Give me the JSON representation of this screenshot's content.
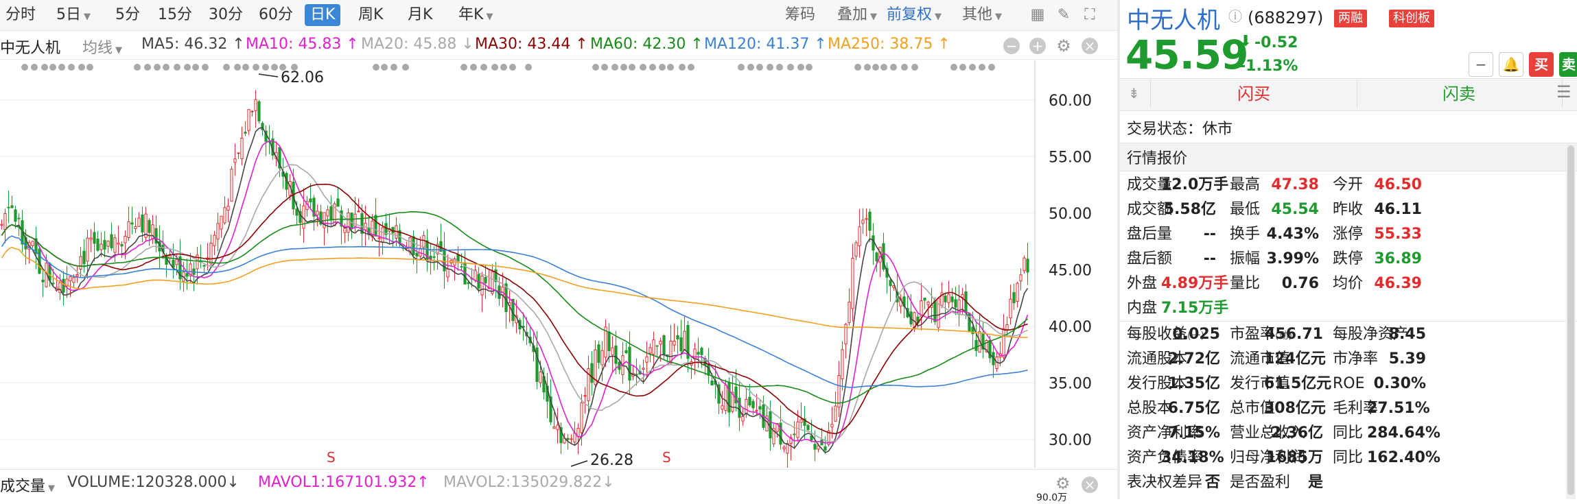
{
  "toolbar": {
    "periods": [
      "分时",
      "5日",
      "5分",
      "15分",
      "30分",
      "60分",
      "日K",
      "周K",
      "月K",
      "年K"
    ],
    "active": "日K",
    "chouma": "筹码",
    "diejia": "叠加",
    "fuquan": "前复权",
    "qita": "其他"
  },
  "ma_line": {
    "name": "中无人机",
    "junxian": "均线",
    "ma5": "MA5: 46.32 ↑",
    "ma10": "MA10: 45.83 ↑",
    "ma20": "MA20: 45.88 ↓",
    "ma30": "MA30: 43.44 ↑",
    "ma60": "MA60: 42.30 ↑",
    "ma120": "MA120: 41.37 ↑",
    "ma250": "MA250: 38.75 ↑",
    "colors": {
      "ma5": "#444444",
      "ma10": "#e020d0",
      "ma20": "#a9a9a9",
      "ma30": "#8b0000",
      "ma60": "#188a18",
      "ma120": "#3b80d6",
      "ma250": "#f0a020"
    }
  },
  "chart": {
    "y_ticks": [
      "60.00",
      "55.00",
      "50.00",
      "45.00",
      "40.00",
      "35.00",
      "30.00"
    ],
    "high_label": "62.06",
    "low_label": "26.28",
    "s_mark": "S",
    "partial_label": "90.0万"
  },
  "volume": {
    "label": "成交量",
    "volume": "VOLUME:120328.000↓",
    "mavol1": "MAVOL1:167101.932↑",
    "mavol2": "MAVOL2:135029.822↓"
  },
  "stock": {
    "name": "中无人机",
    "code": "(688297)",
    "badge1": "两融",
    "badge2": "科创板",
    "price": "45.59",
    "change": "-0.52",
    "change_pct": "-1.13%",
    "btn_sell": "卖",
    "btn_buy": "买",
    "flash_buy": "闪买",
    "flash_sell": "闪卖",
    "status_label": "交易状态：休市",
    "quote_title": "行情报价"
  },
  "quote_rows": [
    [
      [
        "成交量",
        "12.0万手",
        "dk"
      ],
      [
        "最高",
        "47.38",
        "red"
      ],
      [
        "今开",
        "46.50",
        "red"
      ]
    ],
    [
      [
        "成交额",
        "5.58亿",
        "dk"
      ],
      [
        "最低",
        "45.54",
        "green"
      ],
      [
        "昨收",
        "46.11",
        "dk"
      ]
    ],
    [
      [
        "盘后量",
        "--",
        "dk"
      ],
      [
        "换手",
        "4.43%",
        "dk"
      ],
      [
        "涨停",
        "55.33",
        "red"
      ]
    ],
    [
      [
        "盘后额",
        "--",
        "dk"
      ],
      [
        "振幅",
        "3.99%",
        "dk"
      ],
      [
        "跌停",
        "36.89",
        "green"
      ]
    ],
    [
      [
        "外盘",
        "4.89万手",
        "red"
      ],
      [
        "量比",
        "0.76",
        "dk"
      ],
      [
        "均价",
        "46.39",
        "red"
      ]
    ],
    [
      [
        "内盘",
        "7.15万手",
        "green"
      ]
    ]
  ],
  "fin_rows": [
    [
      [
        "每股收益",
        "(一)",
        "0.025"
      ],
      [
        "市盈率",
        "(动)",
        "456.71"
      ],
      [
        "每股净资产",
        "",
        "8.45"
      ]
    ],
    [
      [
        "流通股本",
        "",
        "2.72亿"
      ],
      [
        "流通市值",
        "",
        "124亿元"
      ],
      [
        "市净率",
        "",
        "5.39"
      ]
    ],
    [
      [
        "发行股本",
        "",
        "1.35亿"
      ],
      [
        "发行市值",
        "",
        "61.5亿元"
      ],
      [
        "ROE",
        "",
        "0.30%"
      ]
    ],
    [
      [
        "总股本",
        "",
        "6.75亿"
      ],
      [
        "总市值",
        "",
        "308亿元"
      ],
      [
        "毛利率",
        "",
        "27.51%"
      ]
    ],
    [
      [
        "资产净利率",
        "",
        "7.15%"
      ],
      [
        "营业总收入",
        "",
        "2.36亿"
      ],
      [
        "同比",
        "",
        "284.64%"
      ]
    ],
    [
      [
        "资产负债率",
        "",
        "34.18%"
      ],
      [
        "归母净利润",
        "",
        "1685万"
      ],
      [
        "同比",
        "",
        "162.40%"
      ]
    ],
    [
      [
        "表决权差异",
        "",
        "否"
      ],
      [
        "是否盈利",
        "",
        "是"
      ]
    ]
  ],
  "chart_data": {
    "type": "candlestick",
    "ylim": [
      27.5,
      63.5
    ],
    "y_ticks": [
      60,
      55,
      50,
      45,
      40,
      35,
      30
    ],
    "high": 62.06,
    "low": 26.28,
    "last_close": 45.59
  }
}
